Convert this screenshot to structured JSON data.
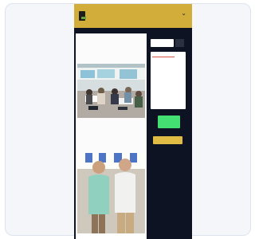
{
  "site": {
    "menu_icon": "chevron-down-icon",
    "logo_icon": "site-logo-icon"
  },
  "article": {
    "title": "",
    "intro": "",
    "caption": "",
    "body": ""
  },
  "sidebar": {
    "search_placeholder": "",
    "search_button_label": "",
    "card_heading": "",
    "links": [
      "",
      "",
      "",
      "",
      "",
      "",
      "",
      "",
      "",
      ""
    ],
    "green_button_label": "",
    "yellow_button_label": ""
  },
  "colors": {
    "header": "#d2ad3a",
    "sidebar_background": "#0d1323",
    "green_button": "#43df72",
    "yellow_button": "#e0bc44",
    "card_accent": "#d65046"
  }
}
